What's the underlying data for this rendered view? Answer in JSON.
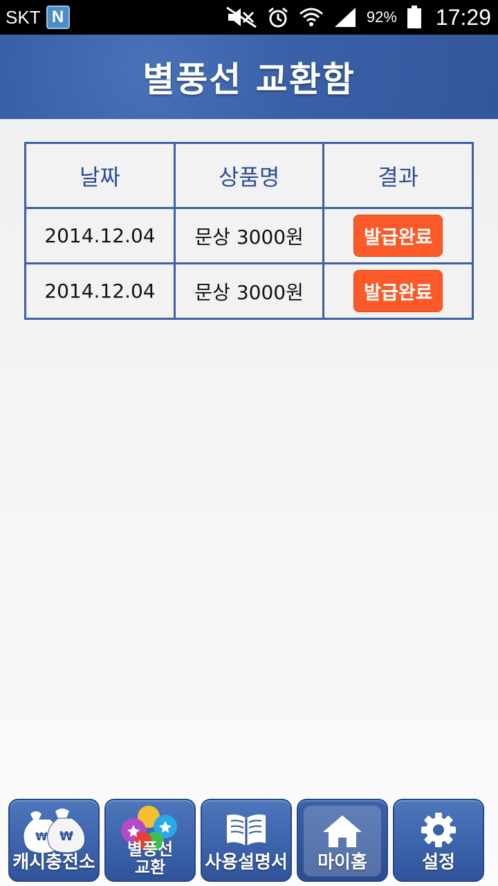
{
  "status_bar": {
    "carrier": "SKT",
    "app_badge": "N",
    "battery_percent": "92%",
    "time": "17:29"
  },
  "header": {
    "title": "별풍선 교환함"
  },
  "table": {
    "headers": [
      "날짜",
      "상품명",
      "결과"
    ],
    "rows": [
      {
        "date": "2014.12.04",
        "product": "문상 3000원",
        "result": "발급완료"
      },
      {
        "date": "2014.12.04",
        "product": "문상 3000원",
        "result": "발급완료"
      }
    ]
  },
  "bottom_nav": {
    "items": [
      {
        "label": "캐시충전소",
        "icon": "money-bag-icon"
      },
      {
        "label": "별풍선\n교환",
        "icon": "balloons-icon"
      },
      {
        "label": "사용설명서",
        "icon": "book-icon"
      },
      {
        "label": "마이홈",
        "icon": "home-icon"
      },
      {
        "label": "설정",
        "icon": "gear-icon"
      }
    ]
  },
  "colors": {
    "header_blue": "#3a60a8",
    "table_border": "#3b60a5",
    "badge_orange": "#fb5a28"
  }
}
